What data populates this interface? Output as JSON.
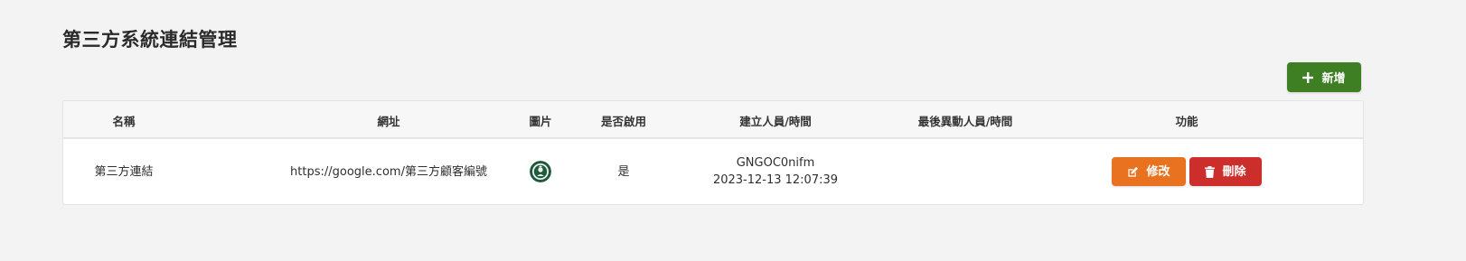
{
  "page": {
    "title": "第三方系統連結管理"
  },
  "toolbar": {
    "add_label": "新增",
    "add_icon": "plus-icon",
    "add_color": "#3d7f22"
  },
  "table": {
    "headers": {
      "name": "名稱",
      "url": "網址",
      "image": "圖片",
      "enabled": "是否啟用",
      "creator": "建立人員/時間",
      "modifier": "最後異動人員/時間",
      "actions": "功能"
    },
    "rows": [
      {
        "name": "第三方連結",
        "url": "https://google.com/第三方顧客編號",
        "image_icon": "starbucks-logo-icon",
        "enabled": "是",
        "creator": "GNGOC0nifm",
        "created_at": "2023-12-13 12:07:39",
        "modifier": "",
        "modified_at": "",
        "edit_label": "修改",
        "edit_color": "#e8721f",
        "delete_label": "刪除",
        "delete_color": "#cc2f2b"
      }
    ]
  }
}
